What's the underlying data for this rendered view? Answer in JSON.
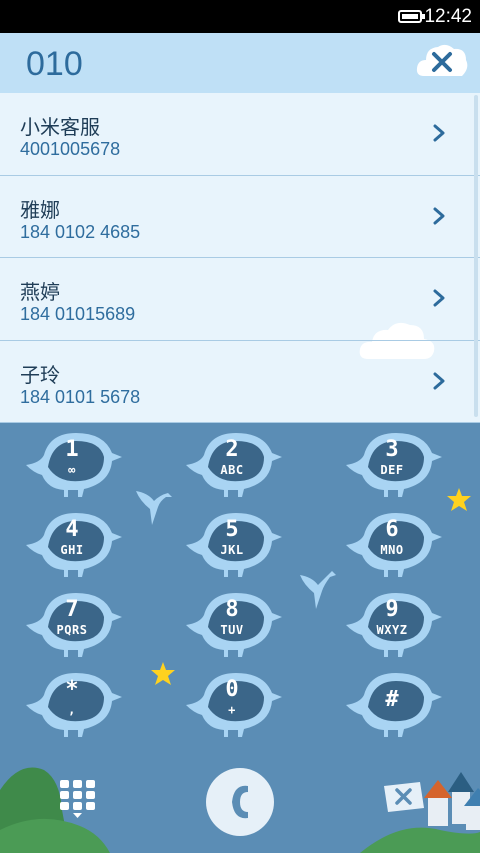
{
  "status_bar": {
    "time": "12:42",
    "battery_level": 1.0
  },
  "dialer": {
    "entered_number": "010"
  },
  "results": [
    {
      "name": "小米客服",
      "number": "4001005678"
    },
    {
      "name": "雅娜",
      "number": "184 0102 4685"
    },
    {
      "name": "燕婷",
      "number": "184 01015689"
    },
    {
      "name": "子玲",
      "number": "184 0101 5678"
    }
  ],
  "keypad": {
    "keys": [
      {
        "digit": "1",
        "letters": "∞"
      },
      {
        "digit": "2",
        "letters": "ABC"
      },
      {
        "digit": "3",
        "letters": "DEF"
      },
      {
        "digit": "4",
        "letters": "GHI"
      },
      {
        "digit": "5",
        "letters": "JKL"
      },
      {
        "digit": "6",
        "letters": "MNO"
      },
      {
        "digit": "7",
        "letters": "PQRS"
      },
      {
        "digit": "8",
        "letters": "TUV"
      },
      {
        "digit": "9",
        "letters": "WXYZ"
      },
      {
        "digit": "*",
        "letters": ","
      },
      {
        "digit": "0",
        "letters": "+"
      },
      {
        "digit": "#",
        "letters": ""
      }
    ]
  },
  "colors": {
    "header_bg": "#bfe0f6",
    "list_bg": "#e8f4fc",
    "keypad_bg": "#5b8db5",
    "bird_light": "#a9d4f3",
    "bird_dark": "#3b6689",
    "star": "#ffd21f"
  }
}
